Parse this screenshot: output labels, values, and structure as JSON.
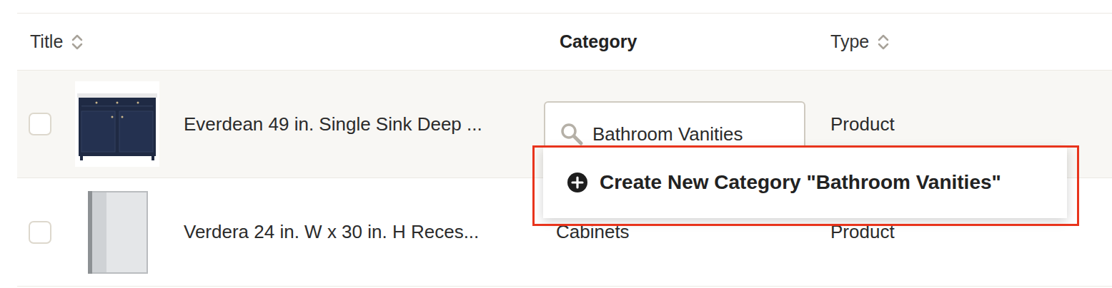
{
  "table": {
    "columns": [
      {
        "label": "Title",
        "sortable": true
      },
      {
        "label": "Category",
        "sortable": false
      },
      {
        "label": "Type",
        "sortable": true
      }
    ],
    "rows": [
      {
        "title": "Everdean 49 in. Single Sink Deep ...",
        "category": "Bathroom Vanities",
        "type": "Product",
        "checked": false,
        "editing": true,
        "kind": "vanity"
      },
      {
        "title": "Verdera 24 in. W x 30 in. H Reces...",
        "category": "Cabinets",
        "type": "Product",
        "checked": false,
        "editing": false,
        "kind": "mirror"
      }
    ]
  },
  "dropdown": {
    "option": "Create New Category \"Bathroom Vanities\"",
    "highlighted": true
  }
}
